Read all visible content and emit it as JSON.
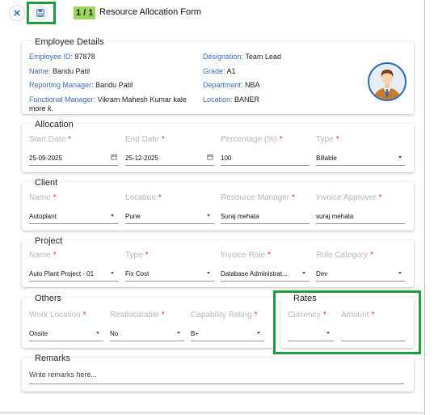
{
  "header": {
    "counter": "1 / 1",
    "title": "Resource Allocation Form"
  },
  "employee": {
    "title": "Employee Details",
    "left": [
      {
        "label": "Employee ID:",
        "value": "87878"
      },
      {
        "label": "Name:",
        "value": "Bandu Patil"
      },
      {
        "label": "Reporting Manager:",
        "value": "Bandu Patil"
      },
      {
        "label": "Functional Manager:",
        "value": "Vikram Mahesh Kumar kale",
        "value2": "more k."
      }
    ],
    "right": [
      {
        "label": "Designation:",
        "value": "Team Lead"
      },
      {
        "label": "Grade:",
        "value": "A1"
      },
      {
        "label": "Department:",
        "value": "NBA"
      },
      {
        "label": "Location:",
        "value": "BANER"
      }
    ]
  },
  "allocation": {
    "title": "Allocation",
    "fields": [
      {
        "label": "Start Date",
        "value": "25-09-2025"
      },
      {
        "label": "End Date",
        "value": "25-12-2025"
      },
      {
        "label": "Percentage (%)",
        "value": "100"
      },
      {
        "label": "Type",
        "value": "Billable"
      }
    ]
  },
  "client": {
    "title": "Client",
    "fields": [
      {
        "label": "Name",
        "value": "Autoplant"
      },
      {
        "label": "Location",
        "value": "Pune"
      },
      {
        "label": "Resource Manager",
        "value": "Suraj mehata"
      },
      {
        "label": "Invoice Approver",
        "value": "suraj mehata"
      }
    ]
  },
  "project": {
    "title": "Project",
    "fields": [
      {
        "label": "Name",
        "value": "Auto Plant Project - 01"
      },
      {
        "label": "Type",
        "value": "Fix Cost"
      },
      {
        "label": "Invoice Role",
        "value": "Database Administrat..."
      },
      {
        "label": "Role Category",
        "value": "Dev"
      }
    ]
  },
  "others": {
    "title": "Others",
    "fields": [
      {
        "label": "Work Location",
        "value": "Onsite"
      },
      {
        "label": "Reallocatable",
        "value": "No"
      },
      {
        "label": "Capability Rating",
        "value": "B+"
      }
    ]
  },
  "rates": {
    "title": "Rates",
    "fields": [
      {
        "label": "Currency",
        "value": ""
      },
      {
        "label": "Amount",
        "value": ""
      }
    ]
  },
  "remarks": {
    "title": "Remarks",
    "placeholder": "Write remarks here..."
  },
  "colors": {
    "highlight": "#1e9e3c",
    "counter_bg": "#9ad65a",
    "key_label": "#3f6fb5",
    "required": "#e53935"
  }
}
